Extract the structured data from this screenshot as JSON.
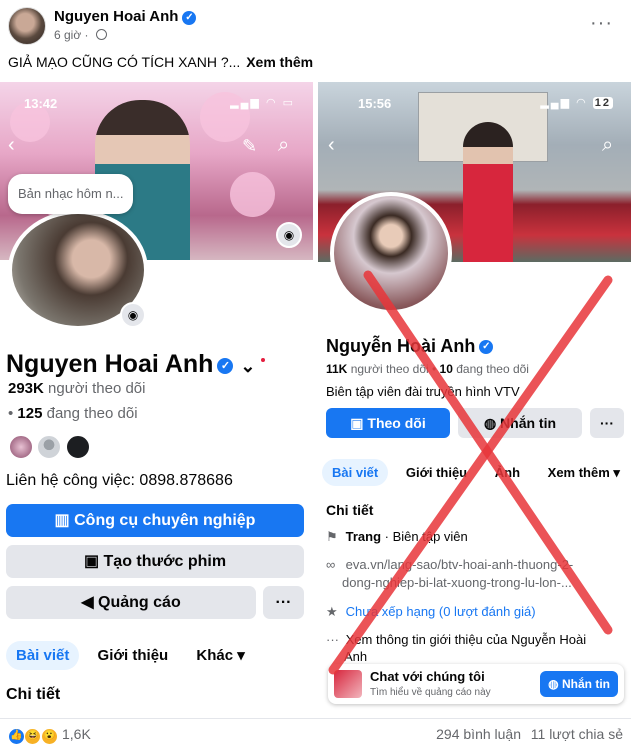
{
  "post": {
    "author": "Nguyen Hoai Anh",
    "time": "6 giờ",
    "caption": "GIẢ MẠO CŨNG CÓ TÍCH XANH ?...",
    "see_more": "Xem thêm",
    "more_icon": "ellipsis-icon"
  },
  "left_profile": {
    "status_time": "13:42",
    "tooltip": "Bản nhạc hôm n...",
    "name": "Nguyen Hoai Anh",
    "followers": "293K",
    "followers_label": "người theo dõi",
    "following": "125",
    "following_label": "đang theo dõi",
    "contact": "Liên hệ công việc: 0898.878686",
    "btn_pro_tools": "Công cụ chuyên nghiệp",
    "btn_create_reel": "Tạo thước phim",
    "btn_advertise": "Quảng cáo",
    "btn_more": "···",
    "tabs": [
      "Bài viết",
      "Giới thiệu",
      "Khác"
    ],
    "details_title": "Chi tiết"
  },
  "right_profile": {
    "status_time": "15:56",
    "battery": "12",
    "name": "Nguyễn Hoài Anh",
    "followers": "11K",
    "followers_label": "người theo dõi",
    "following": "10",
    "following_label": "đang theo dõi",
    "bio": "Biên tập viên đài truyền hình VTV",
    "btn_follow": "Theo dõi",
    "btn_message": "Nhắn tin",
    "btn_more": "···",
    "tabs": [
      "Bài viết",
      "Giới thiệu",
      "Ảnh",
      "Xem thêm"
    ],
    "details_title": "Chi tiết",
    "detail_page": "Trang",
    "detail_page_role": "· Biên tập viên",
    "detail_link_1": "eva.vn/lang-sao/btv-hoai-anh-thuong-2-",
    "detail_link_2": "dong-nghiep-bi-lat-xuong-trong-lu-lon-...",
    "detail_rating": "Chưa xếp hạng (0 lượt đánh giá)",
    "detail_info_1": "Xem thông tin giới thiệu của Nguyễn Hoài",
    "detail_info_2": "Anh",
    "ad_title": "Chat với chúng tôi",
    "ad_sub": "Tìm hiểu về quảng cáo này",
    "ad_button": "Nhắn tin"
  },
  "footer": {
    "reaction_count": "1,6K",
    "comments": "294 bình luận",
    "shares": "11 lượt chia sẻ"
  },
  "colors": {
    "accent": "#1877f2",
    "cross": "#e8363a"
  }
}
